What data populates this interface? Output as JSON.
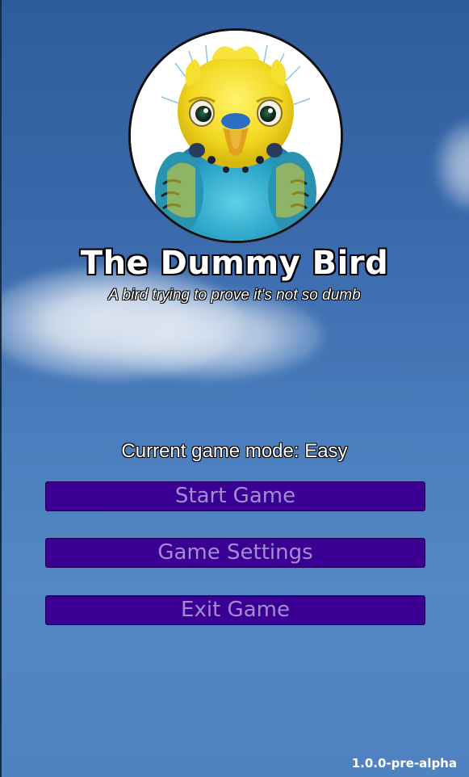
{
  "game": {
    "title": "The Dummy Bird",
    "subtitle": "A bird trying to prove it's not so dumb",
    "mode_label": "Current game mode:",
    "mode_value": "Easy",
    "version": "1.0.0-pre-alpha"
  },
  "menu": {
    "start_label": "Start Game",
    "settings_label": "Game Settings",
    "exit_label": "Exit Game"
  },
  "colors": {
    "button_bg": "#3b0093",
    "button_text": "#a08ed0",
    "sky": "#3a6aac"
  },
  "icons": {
    "avatar": "budgie-bird-portrait"
  }
}
